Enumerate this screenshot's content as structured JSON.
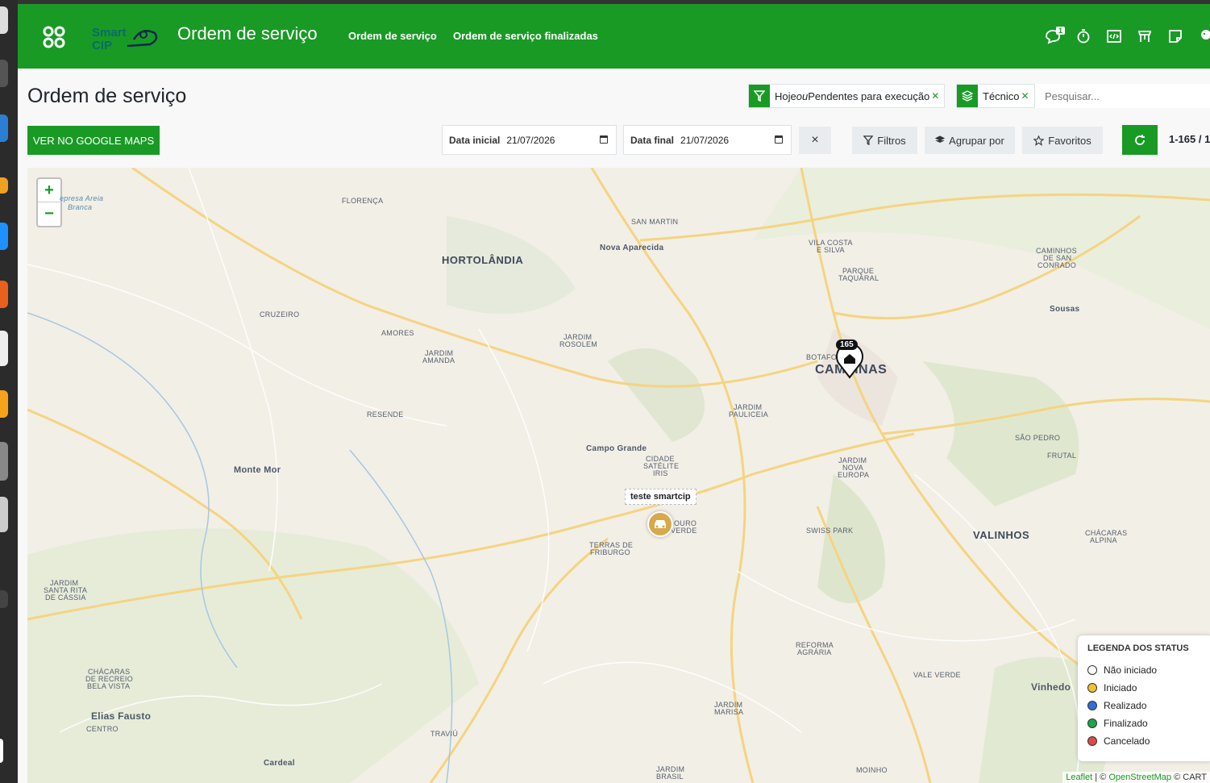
{
  "navbar": {
    "title": "Ordem de serviço",
    "links": [
      "Ordem de serviço",
      "Ordem de serviço finalizadas"
    ],
    "chat_badge": "1",
    "brand_color": "#199a25"
  },
  "control": {
    "title": "Ordem de serviço",
    "facets": [
      {
        "icon": "filter-icon",
        "label_a": "Hoje",
        "sep": "ou",
        "label_b": "Pendentes para execução"
      },
      {
        "icon": "layers-icon",
        "label_a": "Técnico",
        "sep": "",
        "label_b": ""
      }
    ],
    "search_placeholder": "Pesquisar...",
    "google_maps_btn": "VER NO GOOGLE MAPS",
    "date_start_label": "Data inicial",
    "date_start_value": "21/07/2026",
    "date_end_label": "Data final",
    "date_end_value": "21/07/2026",
    "clear": "×",
    "filters": "Filtros",
    "group_by": "Agrupar por",
    "favorites": "Favoritos",
    "pager": "1-165 / 1"
  },
  "map": {
    "zoom_in": "+",
    "zoom_out": "−",
    "places": {
      "florenca": "FLORENÇA",
      "represa": "epresa Areia",
      "branca": "Branca",
      "san_martin": "SAN MARTIN",
      "nova_aparecida": "Nova Aparecida",
      "hortolandia": "HORTOLÂNDIA",
      "vila_costa": "VILA COSTA",
      "e_silva": "E SILVA",
      "parque": "PARQUE",
      "taquaral": "TAQUARAL",
      "caminhos": "CAMINHOS",
      "de_san": "DE SAN",
      "conrado": "CONRADO",
      "sousas": "Sousas",
      "cruzeiro": "CRUZEIRO",
      "amores": "AMORES",
      "jardim_rosolem_1": "JARDIM",
      "jardim_rosolem_2": "ROSOLEM",
      "jardim_amanda_1": "JARDIM",
      "jardim_amanda_2": "AMANDA",
      "botafogo": "BOTAFO",
      "campinas": "CAMPINAS",
      "resende": "RESENDE",
      "jardim_pauliceia_1": "JARDIM",
      "jardim_pauliceia_2": "PAULICEIA",
      "sao_pedro": "SÃO PEDRO",
      "frutal": "FRUTAL",
      "campo_grande": "Campo Grande",
      "cidade_1": "CIDADE",
      "cidade_2": "SATÉLITE",
      "cidade_3": "IRIS",
      "jardim_nova_1": "JARDIM",
      "jardim_nova_2": "NOVA",
      "jardim_nova_3": "EUROPA",
      "monte_mor": "Monte Mor",
      "ouro_1": "OURO",
      "ouro_2": "VERDE",
      "swiss_park": "SWISS PARK",
      "valinhos": "VALINHOS",
      "chacaras_1": "CHÁCARAS",
      "chacaras_2": "ALPINA",
      "terras_1": "TERRAS DE",
      "terras_2": "FRIBURGO",
      "santa_rita_1": "JARDIM",
      "santa_rita_2": "SANTA RITA",
      "santa_rita_3": "DE CÁSSIA",
      "reforma_1": "REFORMA",
      "reforma_2": "AGRÁRIA",
      "vale_verde": "VALE VERDE",
      "chacaras_recreio_1": "CHÁCARAS",
      "chacaras_recreio_2": "DE RECREIO",
      "chacaras_recreio_3": "BELA VISTA",
      "vinhedo": "Vinhedo",
      "jardim_marisa_1": "JARDIM",
      "jardim_marisa_2": "MARISA",
      "elias_fausto": "Elias Fausto",
      "centro": "CENTRO",
      "traviu": "TRAVIÚ",
      "cardeal": "Cardeal",
      "jardim_brasil_1": "JARDIM",
      "jardim_brasil_2": "BRASIL",
      "moinho": "MOINHO"
    },
    "cluster_count": "165",
    "tooltip": "teste smartcip",
    "legend": {
      "title": "LEGENDA DOS STATUS",
      "items": [
        {
          "label": "Não iniciado",
          "color": "#ffffff"
        },
        {
          "label": "Iniciado",
          "color": "#f2c12e"
        },
        {
          "label": "Realizado",
          "color": "#2e6fd8"
        },
        {
          "label": "Finalizado",
          "color": "#1ca54a"
        },
        {
          "label": "Cancelado",
          "color": "#e04848"
        }
      ]
    },
    "attribution": {
      "leaflet": "Leaflet",
      "sep": " | © ",
      "osm": "OpenStreetMap",
      "rest": " © CART"
    }
  }
}
